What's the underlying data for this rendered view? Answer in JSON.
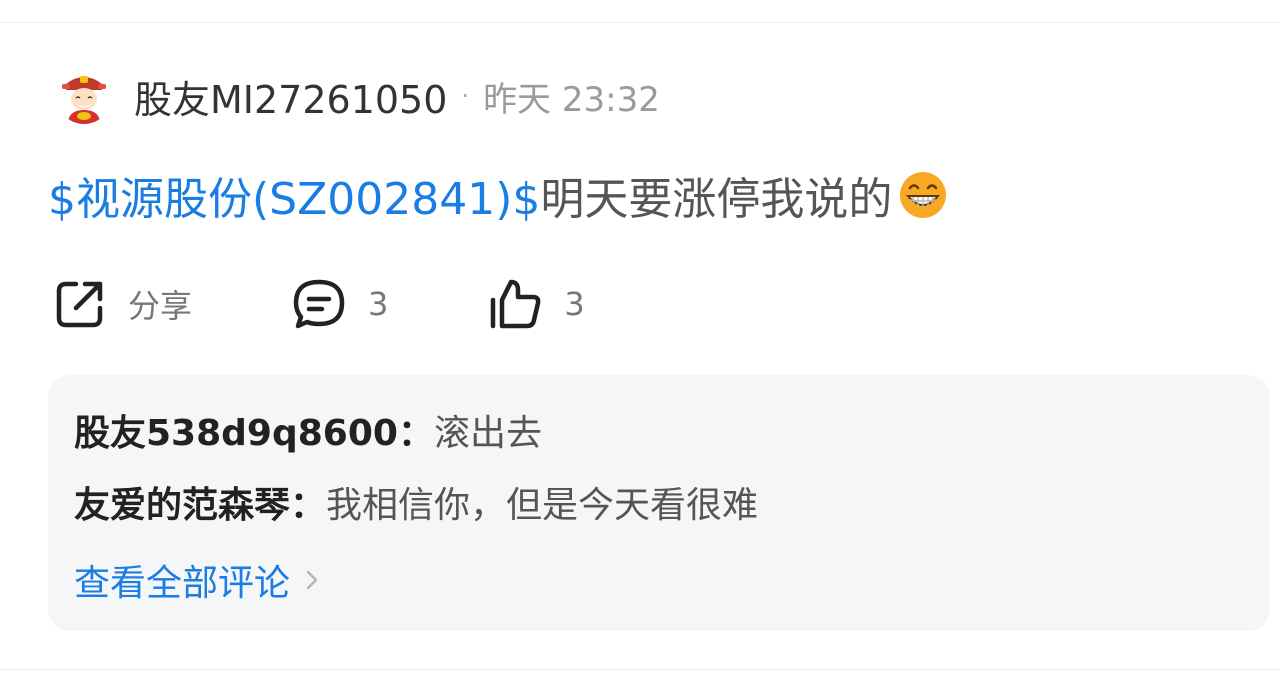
{
  "post": {
    "author": "股友MI27261050",
    "separator": "·",
    "time": "昨天 23:32",
    "stock_tag": "$视源股份(SZ002841)$",
    "text": "明天要涨停我说的",
    "emoji": "grinning-face-emoji"
  },
  "actions": {
    "share_label": "分享",
    "comment_count": "3",
    "like_count": "3"
  },
  "comments": [
    {
      "author": "股友538d9q8600",
      "colon": "：",
      "text": "滚出去"
    },
    {
      "author": "友爱的范森琴",
      "colon": "：",
      "text": "我相信你，但是今天看很难"
    }
  ],
  "view_all_label": "查看全部评论",
  "colors": {
    "link_blue": "#1a7de4",
    "comment_bg": "#f5f6f8"
  }
}
